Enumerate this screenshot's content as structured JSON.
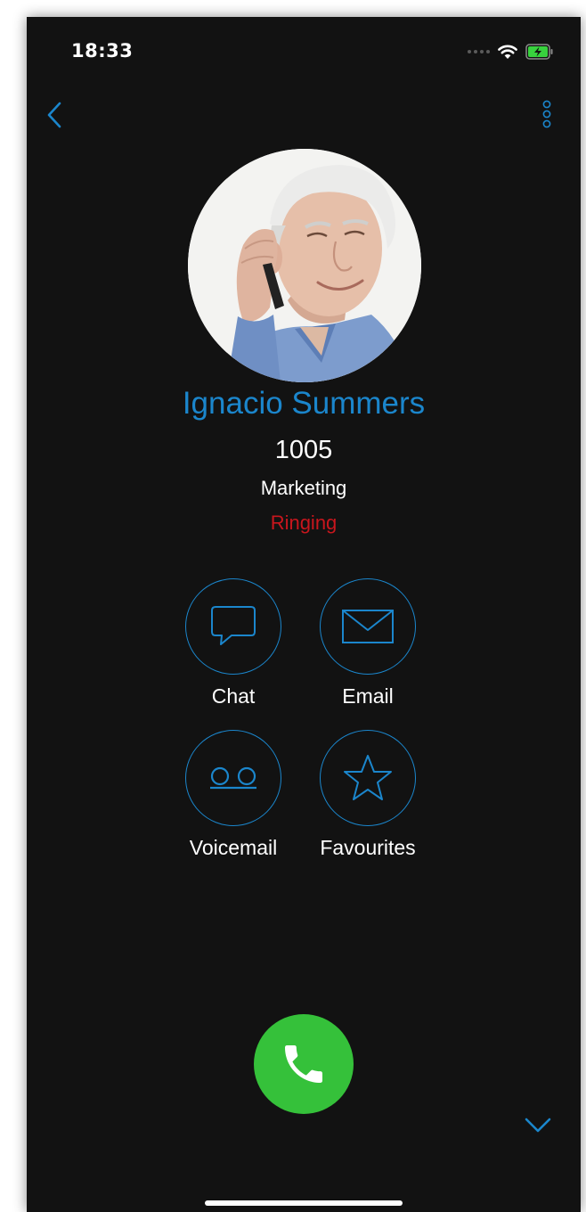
{
  "status_bar": {
    "time": "18:33"
  },
  "icons": {
    "back": "chevron-left-icon",
    "more": "vertical-dots-icon",
    "wifi": "wifi-icon",
    "battery": "battery-charging-icon",
    "chat": "chat-bubble-icon",
    "email": "envelope-icon",
    "voicemail": "voicemail-icon",
    "favourites": "star-icon",
    "call": "phone-icon",
    "collapse": "chevron-down-icon"
  },
  "contact": {
    "name": "Ignacio Summers",
    "extension": "1005",
    "department": "Marketing",
    "call_status": "Ringing"
  },
  "actions": {
    "chat": "Chat",
    "email": "Email",
    "voicemail": "Voicemail",
    "favourites": "Favourites"
  },
  "colors": {
    "background": "#121212",
    "accent": "#1b86cc",
    "status_ringing": "#c8161d",
    "call_button": "#35c13a"
  }
}
